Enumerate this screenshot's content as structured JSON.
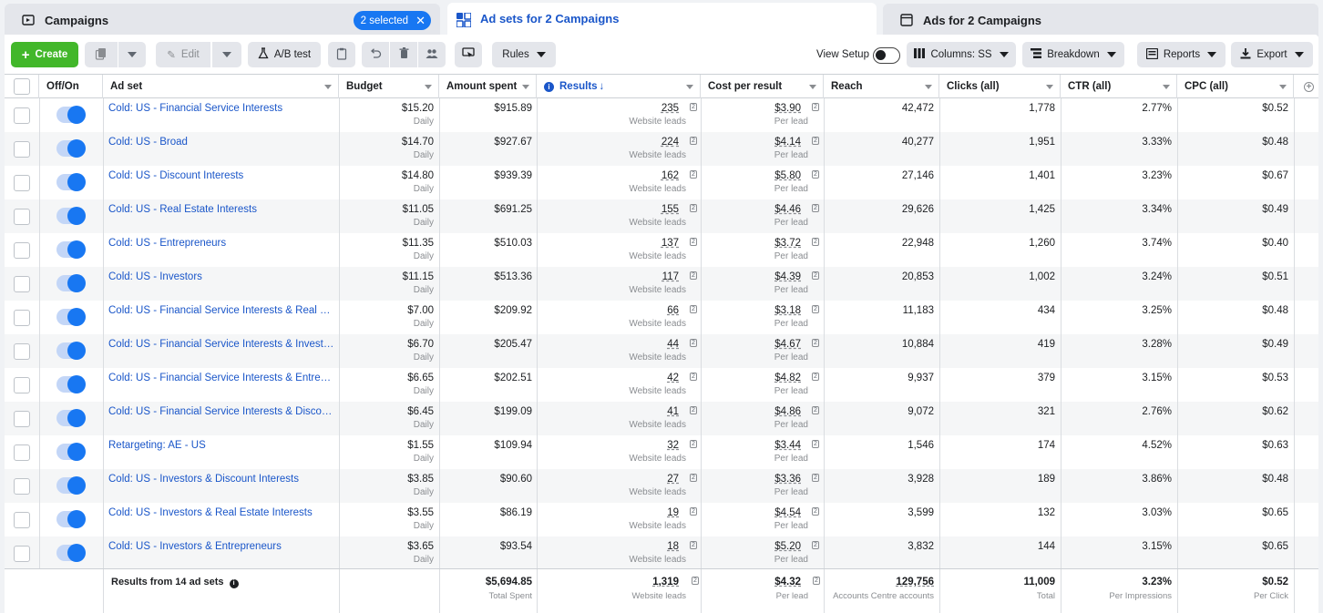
{
  "tabs": {
    "campaigns": {
      "label": "Campaigns",
      "selected_badge": "2 selected"
    },
    "adsets": {
      "label": "Ad sets for 2 Campaigns"
    },
    "ads": {
      "label": "Ads for 2 Campaigns"
    }
  },
  "toolbar": {
    "create": "Create",
    "edit": "Edit",
    "ab_test": "A/B test",
    "rules": "Rules",
    "view_setup": "View Setup",
    "columns": "Columns: SS",
    "breakdown": "Breakdown",
    "reports": "Reports",
    "export": "Export"
  },
  "columns": {
    "off_on": "Off/On",
    "ad_set": "Ad set",
    "budget": "Budget",
    "amount_spent": "Amount spent",
    "results": "Results",
    "cost_per_result": "Cost per result",
    "reach": "Reach",
    "clicks": "Clicks (all)",
    "ctr": "CTR (all)",
    "cpc": "CPC (all)"
  },
  "row_sub": {
    "budget": "Daily",
    "results": "Website leads",
    "cost": "Per lead"
  },
  "rows": [
    {
      "name": "Cold: US - Financial Service Interests",
      "budget": "$15.20",
      "spent": "$915.89",
      "results": "235",
      "cost": "$3.90",
      "reach": "42,472",
      "clicks": "1,778",
      "ctr": "2.77%",
      "cpc": "$0.52"
    },
    {
      "name": "Cold: US - Broad",
      "budget": "$14.70",
      "spent": "$927.67",
      "results": "224",
      "cost": "$4.14",
      "reach": "40,277",
      "clicks": "1,951",
      "ctr": "3.33%",
      "cpc": "$0.48"
    },
    {
      "name": "Cold: US - Discount Interests",
      "budget": "$14.80",
      "spent": "$939.39",
      "results": "162",
      "cost": "$5.80",
      "reach": "27,146",
      "clicks": "1,401",
      "ctr": "3.23%",
      "cpc": "$0.67"
    },
    {
      "name": "Cold: US - Real Estate Interests",
      "budget": "$11.05",
      "spent": "$691.25",
      "results": "155",
      "cost": "$4.46",
      "reach": "29,626",
      "clicks": "1,425",
      "ctr": "3.34%",
      "cpc": "$0.49"
    },
    {
      "name": "Cold: US - Entrepreneurs",
      "budget": "$11.35",
      "spent": "$510.03",
      "results": "137",
      "cost": "$3.72",
      "reach": "22,948",
      "clicks": "1,260",
      "ctr": "3.74%",
      "cpc": "$0.40"
    },
    {
      "name": "Cold: US - Investors",
      "budget": "$11.15",
      "spent": "$513.36",
      "results": "117",
      "cost": "$4.39",
      "reach": "20,853",
      "clicks": "1,002",
      "ctr": "3.24%",
      "cpc": "$0.51"
    },
    {
      "name": "Cold: US - Financial Service Interests & Real Est…",
      "budget": "$7.00",
      "spent": "$209.92",
      "results": "66",
      "cost": "$3.18",
      "reach": "11,183",
      "clicks": "434",
      "ctr": "3.25%",
      "cpc": "$0.48"
    },
    {
      "name": "Cold: US - Financial Service Interests & Investors",
      "budget": "$6.70",
      "spent": "$205.47",
      "results": "44",
      "cost": "$4.67",
      "reach": "10,884",
      "clicks": "419",
      "ctr": "3.28%",
      "cpc": "$0.49"
    },
    {
      "name": "Cold: US - Financial Service Interests & Entrepr…",
      "budget": "$6.65",
      "spent": "$202.51",
      "results": "42",
      "cost": "$4.82",
      "reach": "9,937",
      "clicks": "379",
      "ctr": "3.15%",
      "cpc": "$0.53"
    },
    {
      "name": "Cold: US - Financial Service Interests & Discoun…",
      "budget": "$6.45",
      "spent": "$199.09",
      "results": "41",
      "cost": "$4.86",
      "reach": "9,072",
      "clicks": "321",
      "ctr": "2.76%",
      "cpc": "$0.62"
    },
    {
      "name": "Retargeting: AE - US",
      "budget": "$1.55",
      "spent": "$109.94",
      "results": "32",
      "cost": "$3.44",
      "reach": "1,546",
      "clicks": "174",
      "ctr": "4.52%",
      "cpc": "$0.63"
    },
    {
      "name": "Cold: US - Investors & Discount Interests",
      "budget": "$3.85",
      "spent": "$90.60",
      "results": "27",
      "cost": "$3.36",
      "reach": "3,928",
      "clicks": "189",
      "ctr": "3.86%",
      "cpc": "$0.48"
    },
    {
      "name": "Cold: US - Investors & Real Estate Interests",
      "budget": "$3.55",
      "spent": "$86.19",
      "results": "19",
      "cost": "$4.54",
      "reach": "3,599",
      "clicks": "132",
      "ctr": "3.03%",
      "cpc": "$0.65"
    },
    {
      "name": "Cold: US - Investors & Entrepreneurs",
      "budget": "$3.65",
      "spent": "$93.54",
      "results": "18",
      "cost": "$5.20",
      "reach": "3,832",
      "clicks": "144",
      "ctr": "3.15%",
      "cpc": "$0.65"
    }
  ],
  "footer": {
    "label": "Results from 14 ad sets",
    "spent": "$5,694.85",
    "spent_sub": "Total Spent",
    "results": "1,319",
    "results_sub": "Website leads",
    "cost": "$4.32",
    "cost_sub": "Per lead",
    "reach": "129,756",
    "reach_sub": "Accounts Centre accounts",
    "clicks": "11,009",
    "clicks_sub": "Total",
    "ctr": "3.23%",
    "ctr_sub": "Per Impressions",
    "cpc": "$0.52",
    "cpc_sub": "Per Click"
  }
}
